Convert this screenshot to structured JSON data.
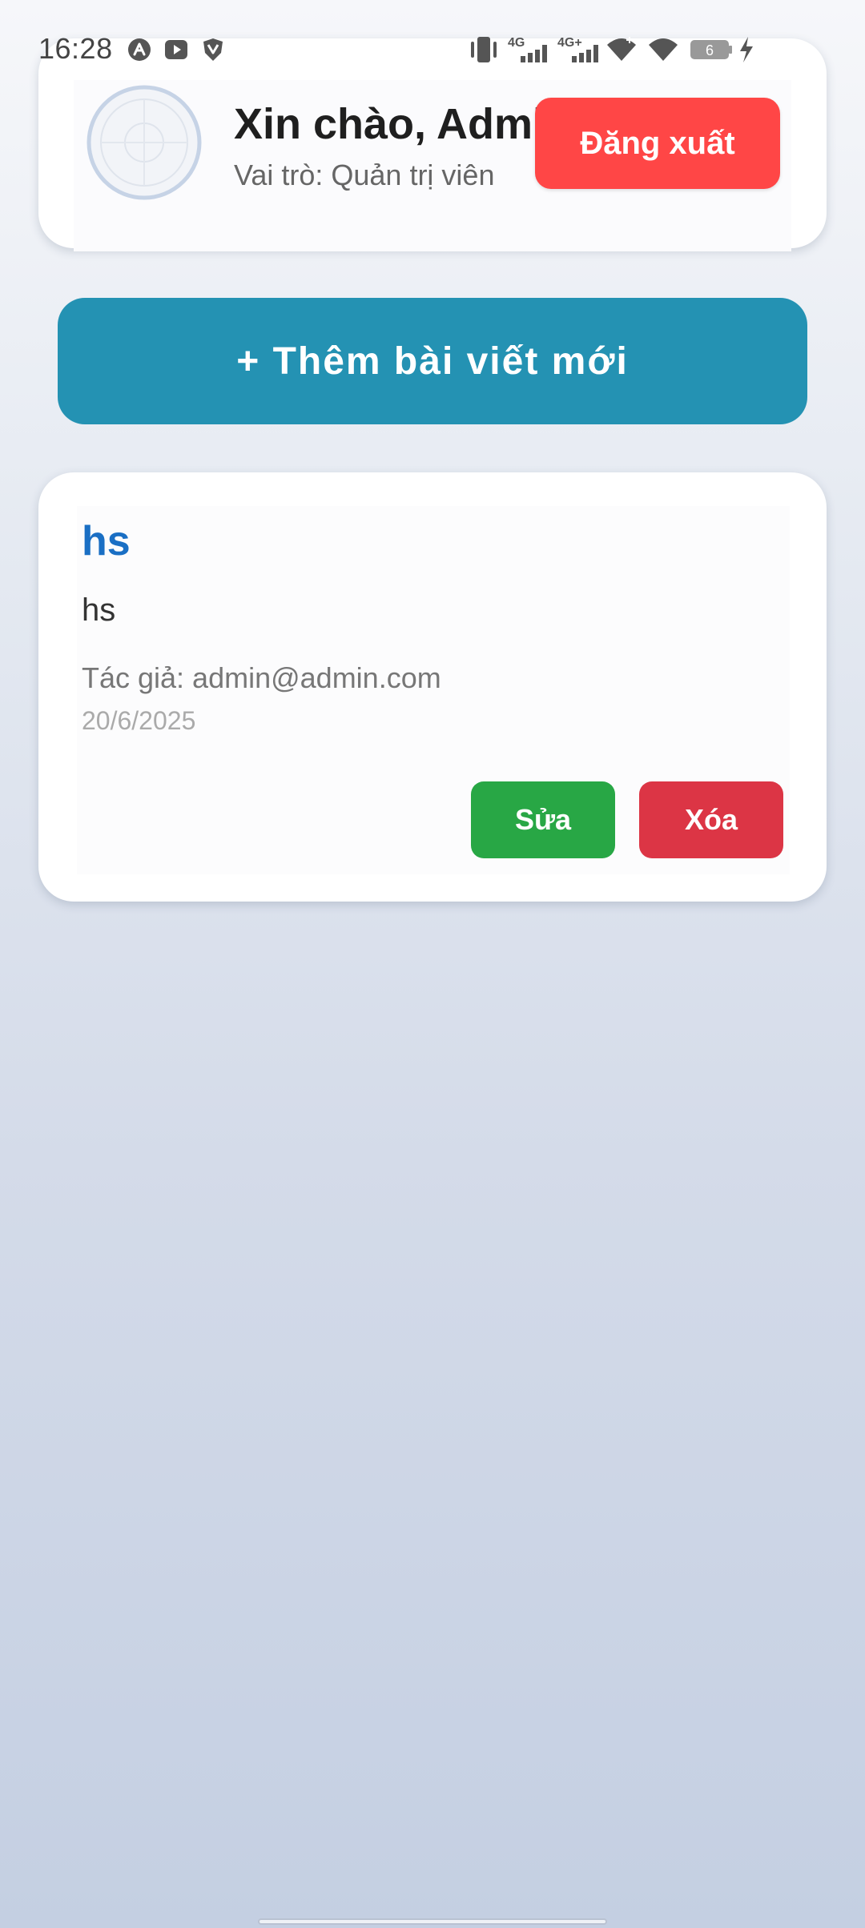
{
  "status_bar": {
    "time": "16:28",
    "network_1": "4G",
    "network_2": "4G+",
    "battery": "6"
  },
  "header": {
    "greeting": "Xin chào, Admin",
    "role": "Vai trò: Quản trị viên",
    "logout_label": "Đăng xuất"
  },
  "actions": {
    "add_post_label": "+ Thêm bài viết mới"
  },
  "posts": [
    {
      "title": "hs",
      "content": "hs",
      "author": "Tác giả: admin@admin.com",
      "date": "20/6/2025",
      "edit_label": "Sửa",
      "delete_label": "Xóa"
    }
  ],
  "colors": {
    "logout": "#ff4646",
    "add_post": "#2492b3",
    "edit": "#28a745",
    "delete": "#dc3545",
    "post_title": "#1a6fc4"
  }
}
